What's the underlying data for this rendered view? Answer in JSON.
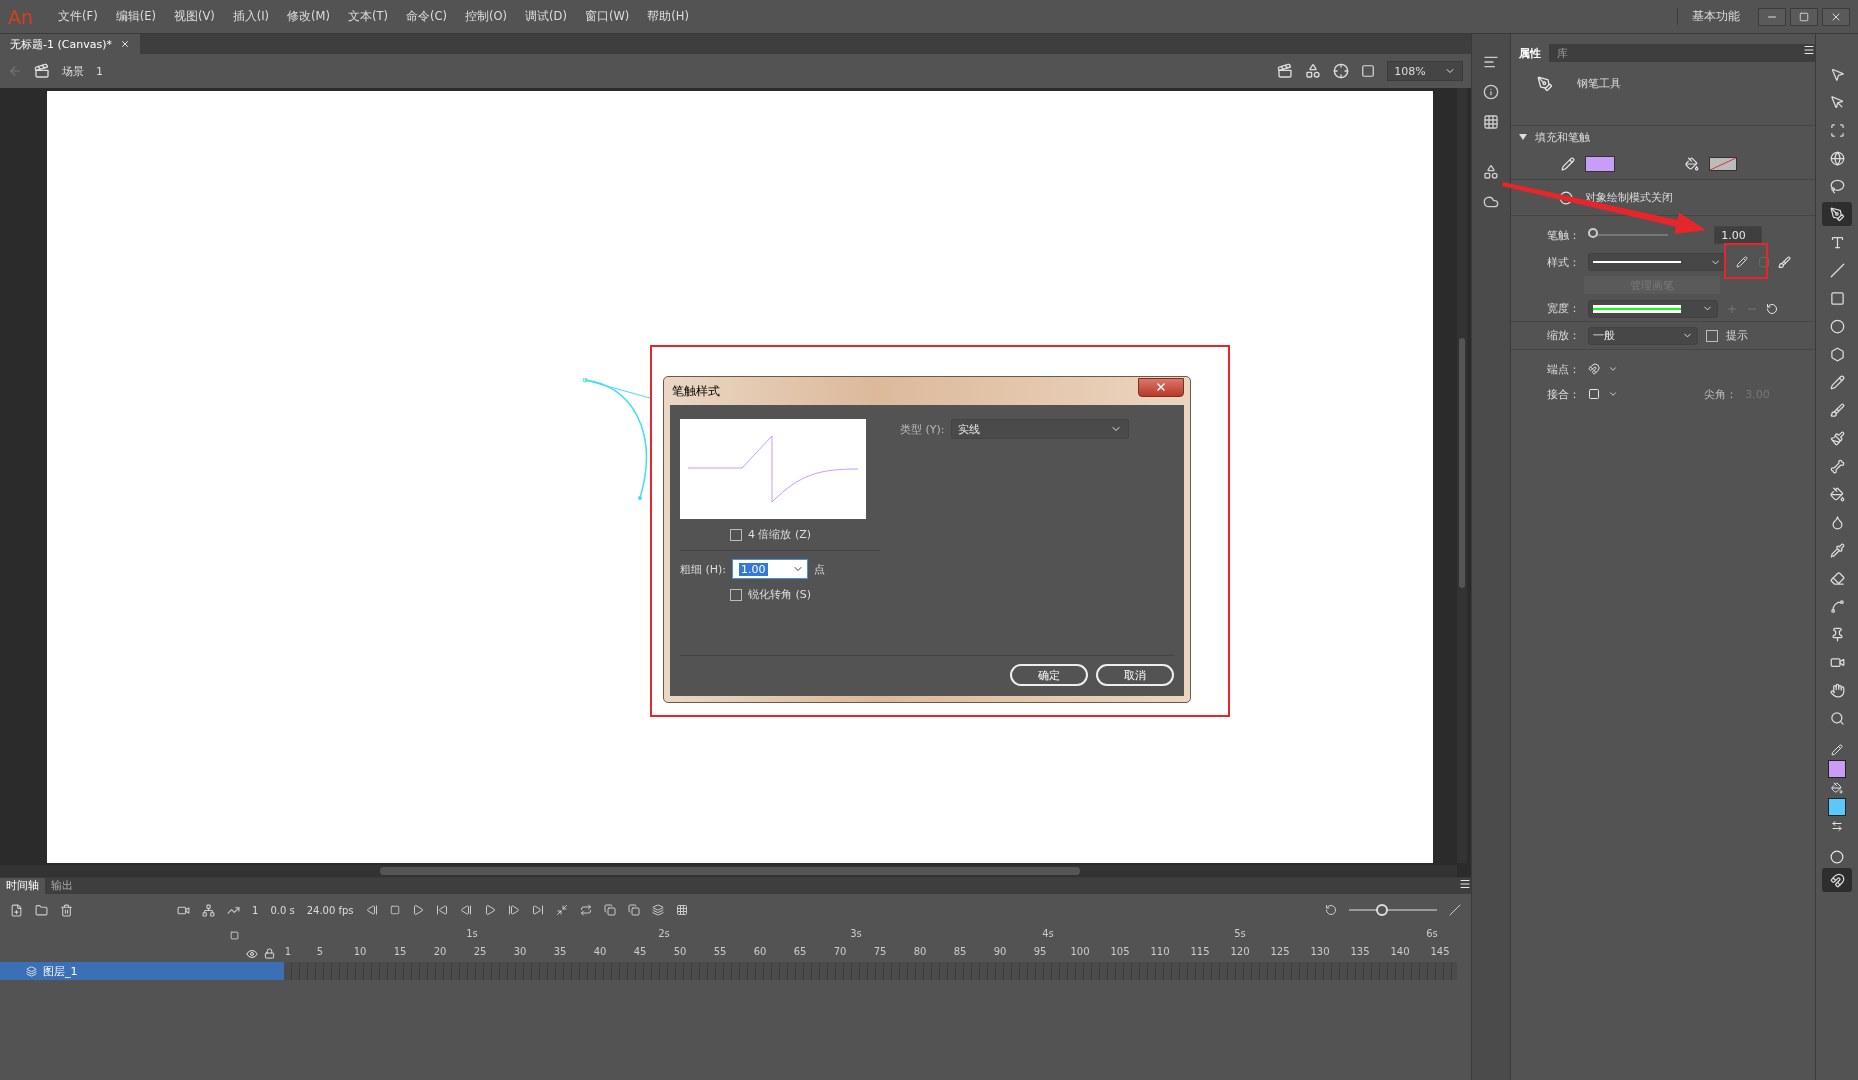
{
  "app": {
    "logo": "An",
    "workspace": "基本功能"
  },
  "menu": [
    "文件(F)",
    "编辑(E)",
    "视图(V)",
    "插入(I)",
    "修改(M)",
    "文本(T)",
    "命令(C)",
    "控制(O)",
    "调试(D)",
    "窗口(W)",
    "帮助(H)"
  ],
  "document_tabs": [
    {
      "label": "无标题-1 (Canvas)*",
      "selected": true
    }
  ],
  "scene": {
    "name": "场景",
    "number": "1",
    "zoom": "108%"
  },
  "dialog": {
    "title": "笔触样式",
    "zoom_4x": {
      "label": "4 倍缩放 (Z)",
      "checked": false
    },
    "thickness": {
      "label": "粗细 (H):",
      "value": "1.00",
      "unit": "点"
    },
    "sharp_corners": {
      "label": "锐化转角 (S)",
      "checked": false
    },
    "type": {
      "label": "类型 (Y):",
      "value": "实线"
    },
    "buttons": [
      "确定",
      "取消"
    ]
  },
  "properties": {
    "tabs": [
      {
        "label": "属性",
        "selected": true
      },
      {
        "label": "库",
        "selected": false
      }
    ],
    "tool_name": "钢笔工具",
    "section": {
      "title": "填充和笔触",
      "expanded": true
    },
    "stroke_swatch": {
      "color": "#c99cf7"
    },
    "object_drawing": "对象绘制模式关闭",
    "stroke": {
      "label": "笔触：",
      "value": "1.00",
      "level": 0
    },
    "style": {
      "label": "样式："
    },
    "manage_brushes": {
      "label": "管理画笔",
      "disabled": true
    },
    "width": {
      "label": "宽度："
    },
    "scale": {
      "label": "缩放：",
      "value": "一般"
    },
    "hint": {
      "label": "提示",
      "checked": false
    },
    "cap": {
      "label": "端点："
    },
    "join": {
      "label": "接合："
    },
    "miter": {
      "label": "尖角：",
      "value": "3.00"
    }
  },
  "tools": [
    {
      "selected": false
    },
    {
      "selected": false
    },
    {
      "selected": false
    },
    {
      "selected": false
    },
    {
      "selected": false
    },
    {
      "selected": true
    },
    {
      "selected": false
    },
    {
      "selected": false
    },
    {
      "selected": false
    },
    {
      "selected": false
    },
    {
      "selected": false
    },
    {
      "selected": false
    },
    {
      "selected": false
    },
    {
      "selected": false
    },
    {
      "selected": false
    },
    {
      "selected": false
    },
    {
      "selected": false
    },
    {
      "selected": false
    },
    {
      "selected": false
    },
    {
      "selected": false
    },
    {
      "selected": false
    },
    {
      "selected": false
    },
    {
      "selected": false
    },
    {
      "selected": false
    }
  ],
  "tool_swatches": [
    {
      "color": "#c99cf7"
    },
    {
      "color": "#5ac8fa"
    }
  ],
  "timeline": {
    "tabs": [
      {
        "label": "时间轴",
        "selected": true
      },
      {
        "label": "输出",
        "selected": false
      }
    ],
    "current_frame": "1",
    "time": "0.0 s",
    "fps": "24.00 fps",
    "seconds": [
      "1s",
      "2s",
      "3s",
      "4s",
      "5s",
      "6s"
    ],
    "frames": [
      "1",
      "5",
      "10",
      "15",
      "20",
      "25",
      "30",
      "35",
      "40",
      "45",
      "50",
      "55",
      "60",
      "65",
      "70",
      "75",
      "80",
      "85",
      "90",
      "95",
      "100",
      "105",
      "110",
      "115",
      "120",
      "125",
      "130",
      "135",
      "140",
      "145"
    ],
    "layers": [
      {
        "name": "图层_1",
        "selected": true
      }
    ],
    "zoom_slider": {
      "level": 0.35
    }
  }
}
